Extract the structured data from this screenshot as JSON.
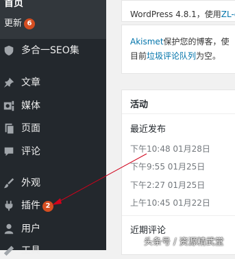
{
  "sidebar": {
    "home": "首页",
    "updates_label": "更新",
    "updates_count": "6",
    "items": [
      {
        "label": "多合一SEO集",
        "icon": "seo-shield-icon"
      },
      {
        "label": "文章",
        "icon": "pin-icon"
      },
      {
        "label": "媒体",
        "icon": "media-icon"
      },
      {
        "label": "页面",
        "icon": "pages-icon"
      },
      {
        "label": "评论",
        "icon": "comment-icon"
      },
      {
        "label": "外观",
        "icon": "paintbrush-icon"
      },
      {
        "label": "插件",
        "icon": "plugin-icon",
        "badge": "2"
      },
      {
        "label": "用户",
        "icon": "user-icon"
      },
      {
        "label": "工具",
        "icon": "tools-icon"
      }
    ]
  },
  "main": {
    "version_text": "WordPress 4.8.1，使用",
    "theme_link": "ZL-c",
    "akismet_line1_prefix": "Akismet",
    "akismet_line1_text": "保护您的博客，使",
    "akismet_line2_prefix": "目前",
    "akismet_link": "垃圾评论队列",
    "akismet_line2_suffix": "为空。",
    "activity_title": "活动",
    "recent_title": "最近发布",
    "dates": [
      "下午10:48 01月28日",
      "下午9:55 01月25日",
      "下午2:27 01月25日",
      "上午10:45 01月22日"
    ],
    "comments_title": "近期评论"
  },
  "watermark": "头条号 / 资源精武堂",
  "colors": {
    "sidebar_bg": "#23282d",
    "badge": "#d54e21",
    "link": "#0073aa",
    "arrow": "#d0021b"
  }
}
